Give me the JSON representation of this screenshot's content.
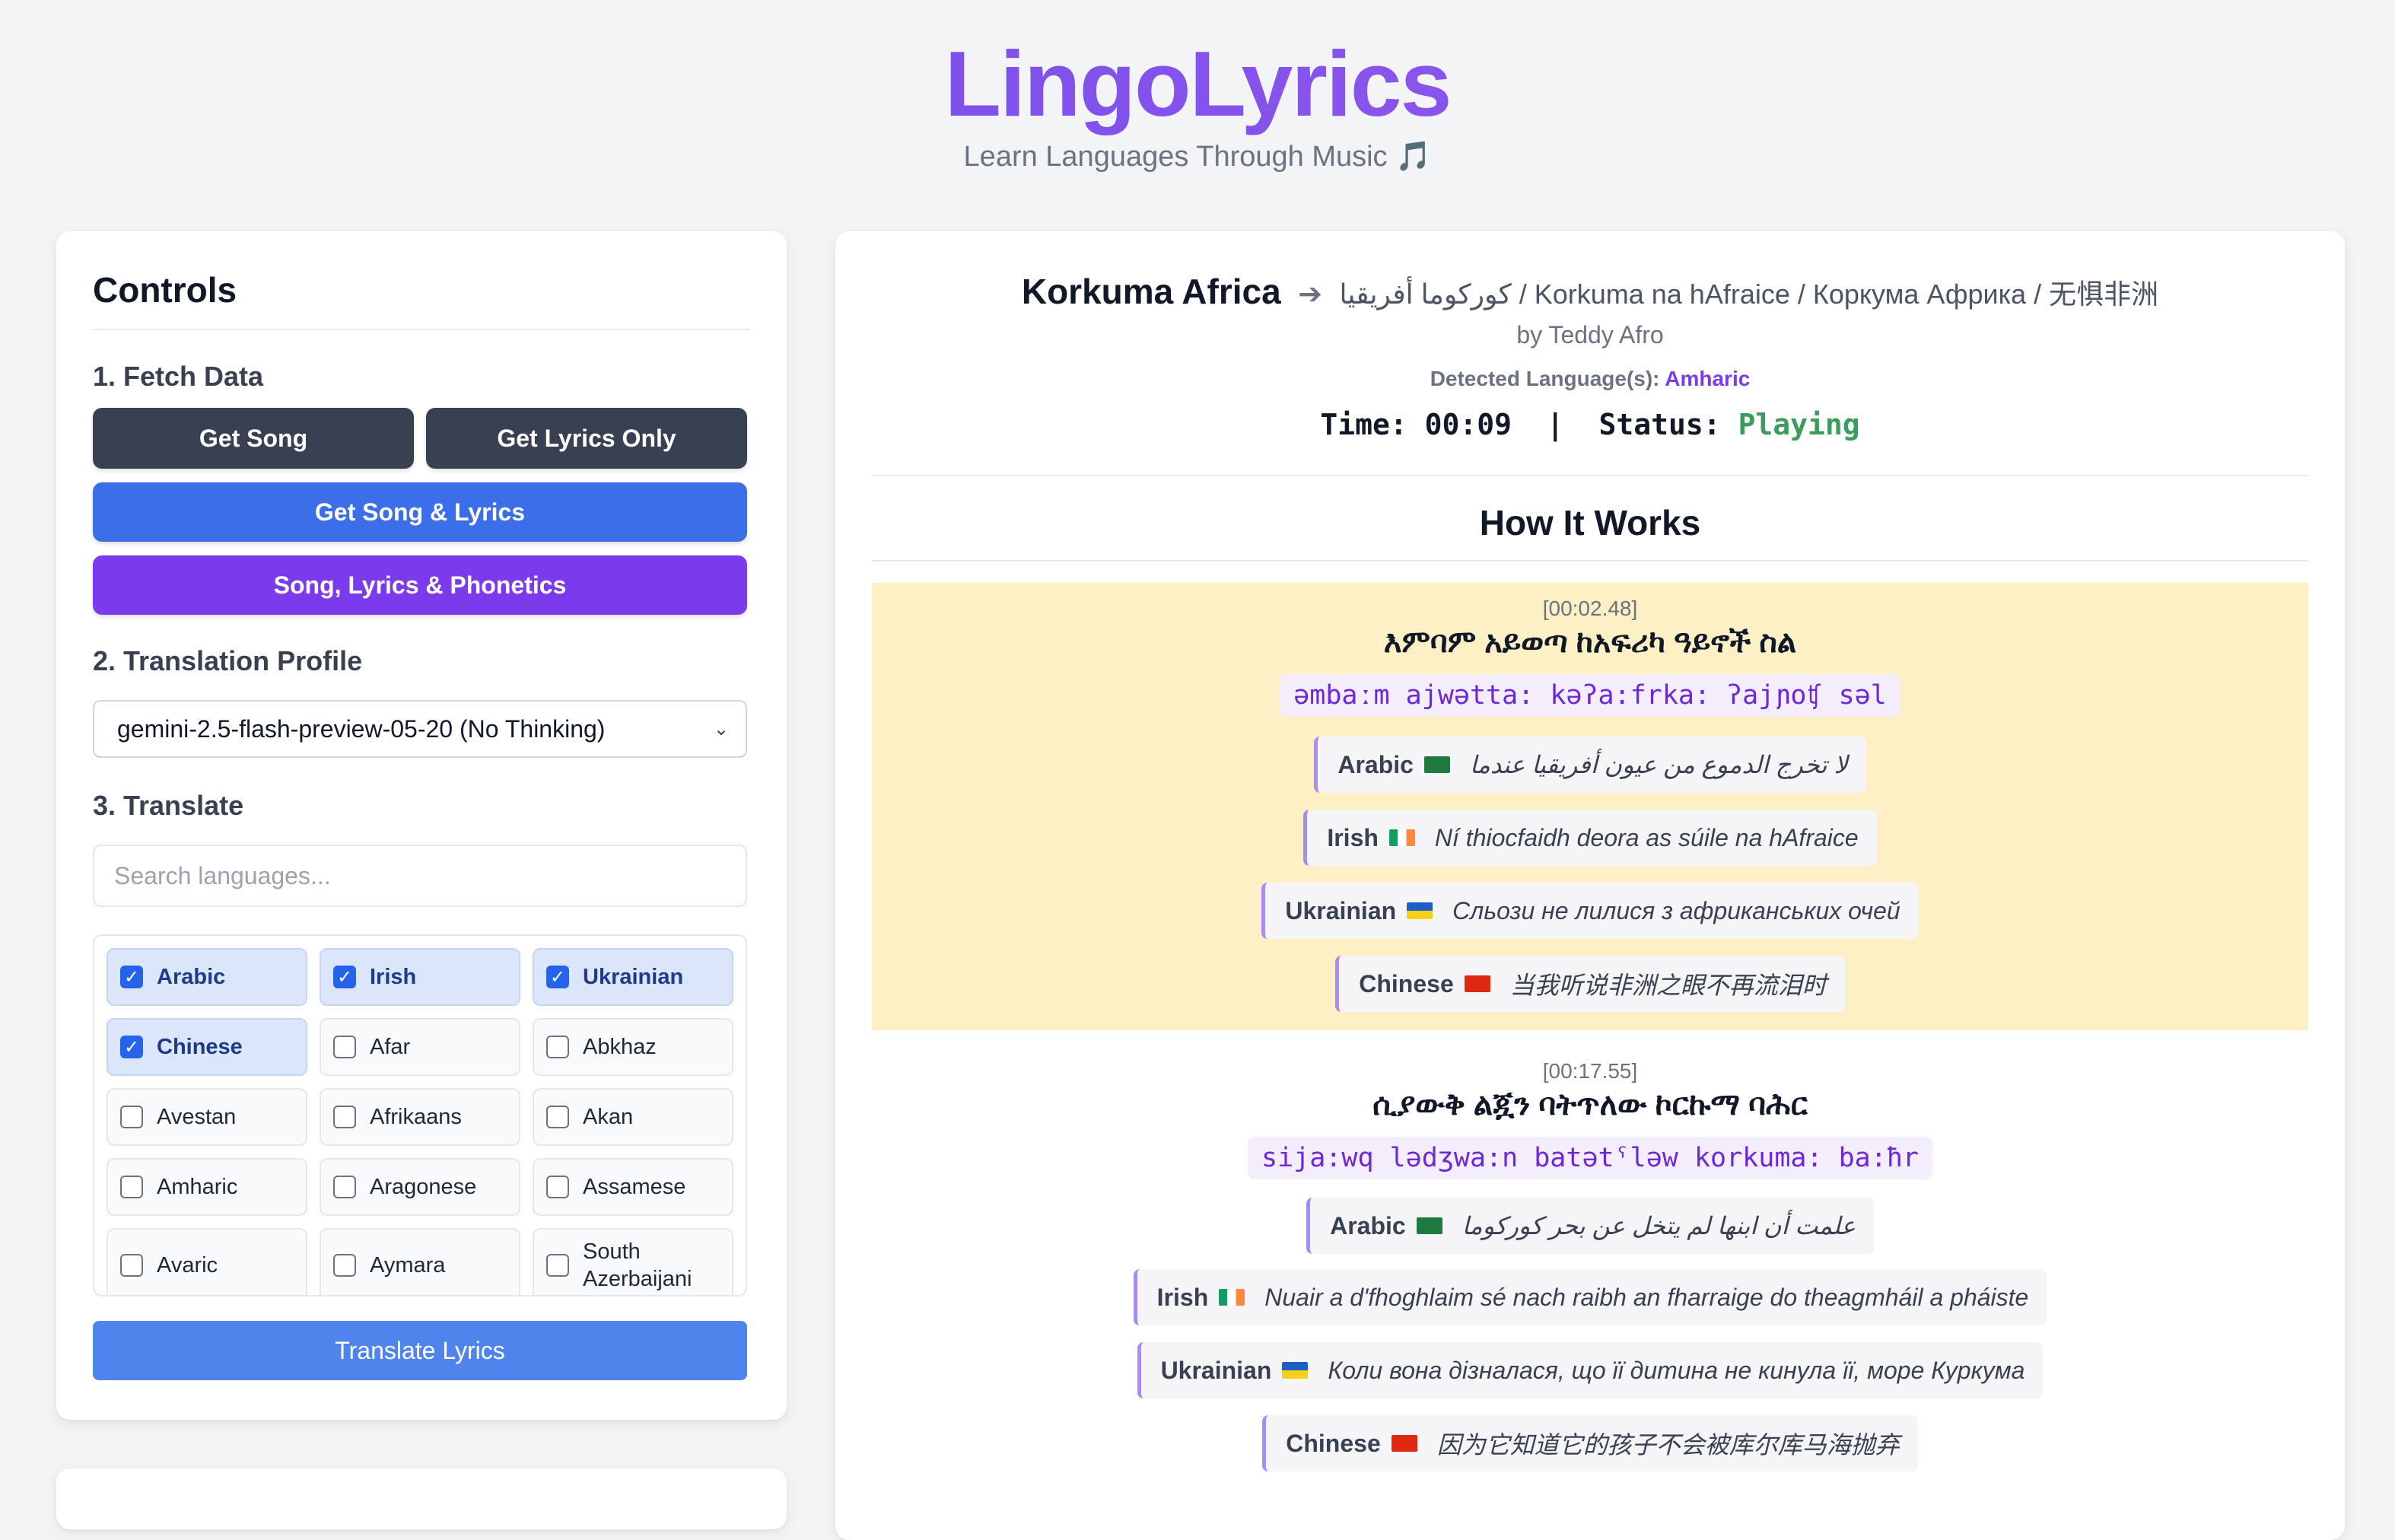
{
  "header": {
    "title": "LingoLyrics",
    "subtitle": "Learn Languages Through Music 🎵"
  },
  "controls": {
    "title": "Controls",
    "fetch_label": "1. Fetch Data",
    "get_song": "Get Song",
    "get_lyrics_only": "Get Lyrics Only",
    "get_song_lyrics": "Get Song & Lyrics",
    "song_lyrics_phonetics": "Song, Lyrics & Phonetics",
    "profile_label": "2. Translation Profile",
    "profile_selected": "gemini-2.5-flash-preview-05-20 (No Thinking)",
    "translate_label": "3. Translate",
    "search_placeholder": "Search languages...",
    "languages": [
      {
        "name": "Arabic",
        "checked": true
      },
      {
        "name": "Irish",
        "checked": true
      },
      {
        "name": "Ukrainian",
        "checked": true
      },
      {
        "name": "Chinese",
        "checked": true
      },
      {
        "name": "Afar",
        "checked": false
      },
      {
        "name": "Abkhaz",
        "checked": false
      },
      {
        "name": "Avestan",
        "checked": false
      },
      {
        "name": "Afrikaans",
        "checked": false
      },
      {
        "name": "Akan",
        "checked": false
      },
      {
        "name": "Amharic",
        "checked": false
      },
      {
        "name": "Aragonese",
        "checked": false
      },
      {
        "name": "Assamese",
        "checked": false
      },
      {
        "name": "Avaric",
        "checked": false
      },
      {
        "name": "Aymara",
        "checked": false
      },
      {
        "name": "South Azerbaijani",
        "checked": false
      }
    ],
    "translate_button": "Translate Lyrics"
  },
  "song": {
    "title": "Korkuma Africa",
    "translated_titles": "كوركوما أفريقيا / Korkuma na hAfraice / Коркума Африка / 无惧非洲",
    "artist": "by Teddy Afro",
    "detected_label": "Detected Language(s):",
    "detected_language": "Amharic",
    "time_label": "Time:",
    "time_value": "00:09",
    "status_label": "Status:",
    "status_value": "Playing"
  },
  "how_it_works": "How It Works",
  "lyrics": [
    {
      "timestamp": "[00:02.48]",
      "original": "እምባም አይወጣ ከአፍሪካ ዓይኖች ስል",
      "phonetic": "əmbaːm ajwətta: kəʔa:frka: ʔajɲoʧ səl",
      "translations": [
        {
          "lang": "Arabic",
          "text": "لا تخرج الدموع من عيون أفريقيا عندما"
        },
        {
          "lang": "Irish",
          "text": "Ní thiocfaidh deora as súile na hAfraice"
        },
        {
          "lang": "Ukrainian",
          "text": "Сльози не лилися з африканських очей"
        },
        {
          "lang": "Chinese",
          "text": "当我听说非洲之眼不再流泪时"
        }
      ]
    },
    {
      "timestamp": "[00:17.55]",
      "original": "ሲያውቅ ልጇን ባትጥለው ኮርኩማ ባሕር",
      "phonetic": "sija:wq lədʒwa:n batətˤləw korkuma: ba:ħr",
      "translations": [
        {
          "lang": "Arabic",
          "text": "علمت أن ابنها لم يتخل عن بحر كوركوما"
        },
        {
          "lang": "Irish",
          "text": "Nuair a d'fhoghlaim sé nach raibh an fharraige do theagmháil a pháiste"
        },
        {
          "lang": "Ukrainian",
          "text": "Коли вона дізналася, що її дитина не кинула її, море Куркума"
        },
        {
          "lang": "Chinese",
          "text": "因为它知道它的孩子不会被库尔库马海抛弃"
        }
      ]
    }
  ],
  "colors": {
    "brand": "#7c4dec",
    "button_dark": "#374151",
    "button_blue": "#3b6ee8",
    "button_purple": "#7c3aed",
    "active_line": "#fcf0c4",
    "playing": "#3a9d5d"
  }
}
